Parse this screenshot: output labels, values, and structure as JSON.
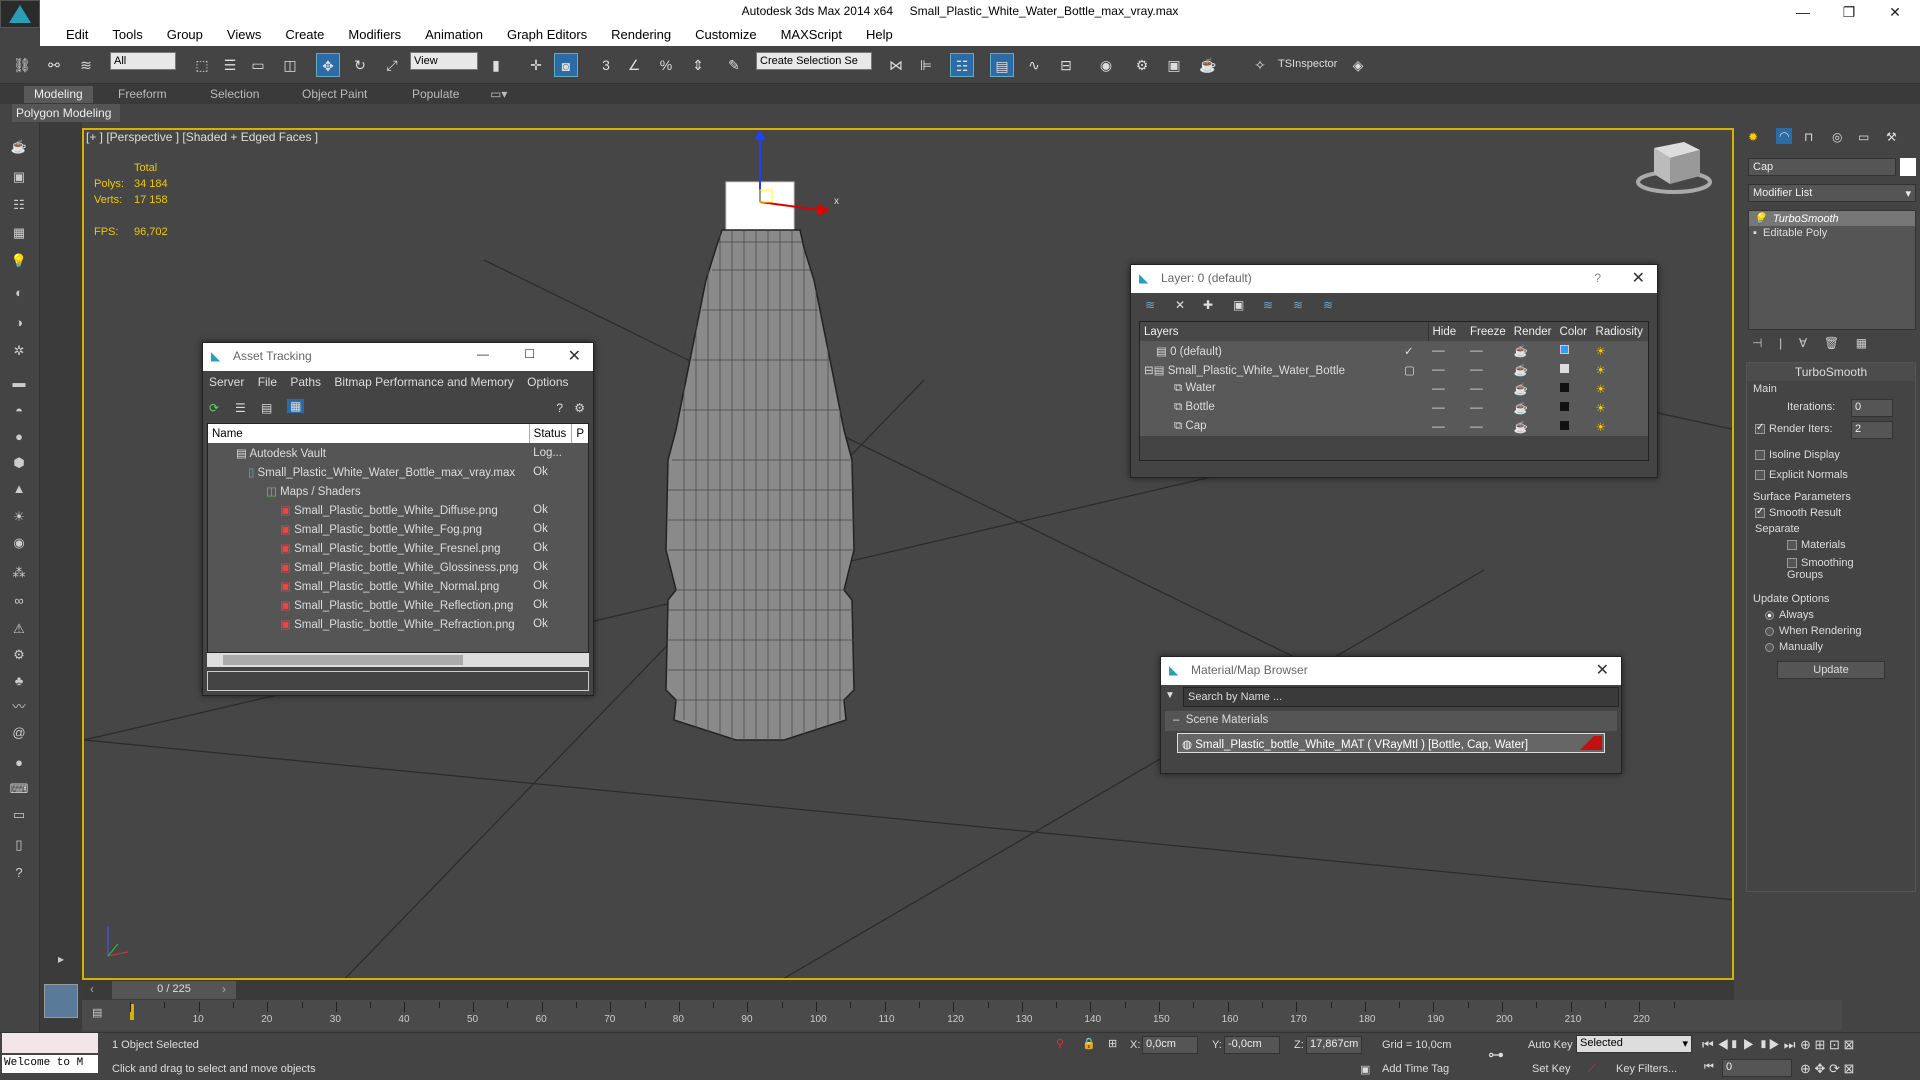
{
  "title": {
    "app": "Autodesk 3ds Max  2014 x64",
    "file": "Small_Plastic_White_Water_Bottle_max_vray.max"
  },
  "menu": [
    "Edit",
    "Tools",
    "Group",
    "Views",
    "Create",
    "Modifiers",
    "Animation",
    "Graph Editors",
    "Rendering",
    "Customize",
    "MAXScript",
    "Help"
  ],
  "toolbar": {
    "filter": "All",
    "refcoord": "View",
    "selection_set": "Create Selection Se",
    "tsinspector": "TSInspector"
  },
  "ribbon": {
    "tabs": [
      "Modeling",
      "Freeform",
      "Selection",
      "Object Paint",
      "Populate"
    ],
    "sub": "Polygon Modeling"
  },
  "viewport": {
    "label": "[+ ] [Perspective ] [Shaded + Edged Faces ]",
    "stats": {
      "total": "Total",
      "polys_label": "Polys:",
      "polys": "34 184",
      "verts_label": "Verts:",
      "verts": "17 158",
      "fps_label": "FPS:",
      "fps": "96,702"
    },
    "axis_x": "x"
  },
  "asset_tracking": {
    "title": "Asset Tracking",
    "menu": [
      "Server",
      "File",
      "Paths",
      "Bitmap Performance and Memory",
      "Options"
    ],
    "col_name": "Name",
    "col_status": "Status",
    "col_p": "P",
    "rows": [
      {
        "name": "Autodesk Vault",
        "status": "Log..."
      },
      {
        "name": "Small_Plastic_White_Water_Bottle_max_vray.max",
        "status": "Ok"
      },
      {
        "name": "Maps / Shaders",
        "status": ""
      },
      {
        "name": "Small_Plastic_bottle_White_Diffuse.png",
        "status": "Ok"
      },
      {
        "name": "Small_Plastic_bottle_White_Fog.png",
        "status": "Ok"
      },
      {
        "name": "Small_Plastic_bottle_White_Fresnel.png",
        "status": "Ok"
      },
      {
        "name": "Small_Plastic_bottle_White_Glossiness.png",
        "status": "Ok"
      },
      {
        "name": "Small_Plastic_bottle_White_Normal.png",
        "status": "Ok"
      },
      {
        "name": "Small_Plastic_bottle_White_Reflection.png",
        "status": "Ok"
      },
      {
        "name": "Small_Plastic_bottle_White_Refraction.png",
        "status": "Ok"
      }
    ]
  },
  "layer": {
    "title": "Layer: 0 (default)",
    "help": "?",
    "cols": [
      "Layers",
      "Hide",
      "Freeze",
      "Render",
      "Color",
      "Radiosity"
    ],
    "rows": [
      {
        "name": "0 (default)"
      },
      {
        "name": "Small_Plastic_White_Water_Bottle"
      },
      {
        "name": "Water"
      },
      {
        "name": "Bottle"
      },
      {
        "name": "Cap"
      }
    ]
  },
  "material_browser": {
    "title": "Material/Map Browser",
    "search_placeholder": "Search by Name ...",
    "section": "Scene Materials",
    "item": "Small_Plastic_bottle_White_MAT  ( VRayMtl ) [Bottle, Cap, Water]"
  },
  "command_panel": {
    "object_name": "Cap",
    "modifier_list": "Modifier List",
    "stack": [
      "TurboSmooth",
      "Editable Poly"
    ],
    "rollout": "TurboSmooth",
    "main": "Main",
    "iterations_label": "Iterations:",
    "iterations": "0",
    "render_iters_label": "Render Iters:",
    "render_iters": "2",
    "isoline": "Isoline Display",
    "explicit": "Explicit Normals",
    "surface": "Surface Parameters",
    "smooth_result": "Smooth Result",
    "separate": "Separate",
    "materials": "Materials",
    "smoothing_groups": "Smoothing Groups",
    "update_options": "Update Options",
    "always": "Always",
    "when_rendering": "When Rendering",
    "manually": "Manually",
    "update": "Update"
  },
  "timeline": {
    "frame": "0 / 225",
    "ticks": [
      "10",
      "20",
      "30",
      "40",
      "50",
      "60",
      "70",
      "80",
      "90",
      "100",
      "110",
      "120",
      "130",
      "140",
      "150",
      "160",
      "170",
      "180",
      "190",
      "200",
      "210",
      "220"
    ]
  },
  "status": {
    "listener": "Welcome to M",
    "selected": "1 Object Selected",
    "hint": "Click and drag to select and move objects",
    "x_label": "X:",
    "x": "0,0cm",
    "y_label": "Y:",
    "y": "-0,0cm",
    "z_label": "Z:",
    "z": "17,867cm",
    "grid": "Grid = 10,0cm",
    "add_time_tag": "Add Time Tag",
    "auto_key": "Auto Key",
    "set_key": "Set Key",
    "selected_dd": "Selected",
    "key_filters": "Key Filters...",
    "frame_field": "0"
  }
}
